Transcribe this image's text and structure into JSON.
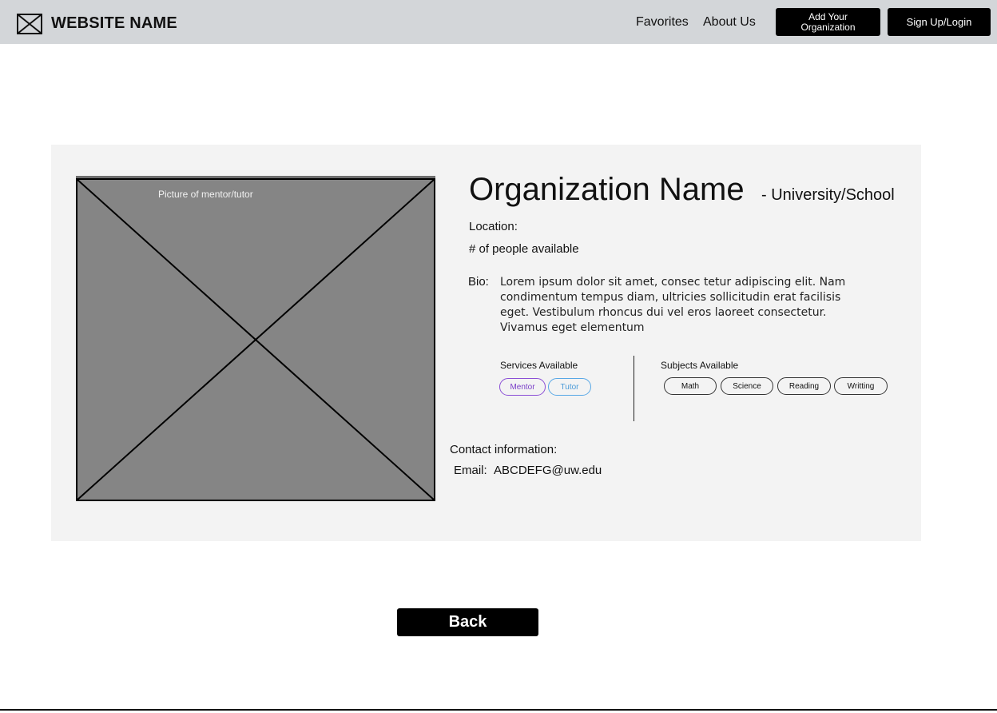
{
  "header": {
    "site_name": "WEBSITE NAME",
    "logo_icon": "image-placeholder-icon",
    "nav": {
      "favorites": "Favorites",
      "about": "About Us"
    },
    "add_org_line1": "Add Your",
    "add_org_line2": "Organization",
    "signup": "Sign Up/Login"
  },
  "profile": {
    "photo_label": "Picture of mentor/tutor",
    "org_name": "Organization Name",
    "org_type": "- University/School",
    "location_label": "Location:",
    "people_label": "# of people available",
    "bio_label": "Bio:",
    "bio_text": "Lorem ipsum dolor sit amet, consec tetur adipiscing elit. Nam condimentum tempus diam, ultricies sollicitudin erat facilisis eget. Vestibulum rhoncus dui vel eros laoreet consectetur. Vivamus eget elementum",
    "services_title": "Services Available",
    "services": [
      "Mentor",
      "Tutor"
    ],
    "subjects_title": "Subjects Available",
    "subjects": [
      "Math",
      "Science",
      "Reading",
      "Writting"
    ],
    "contact_title": "Contact information:",
    "email_label": "Email:",
    "email_value": "ABCDEFG@uw.edu"
  },
  "footer": {
    "back": "Back"
  },
  "colors": {
    "header_bg": "#d3d6d9",
    "card_bg": "#f3f3f3",
    "mentor": "#8b4fd6",
    "tutor": "#58a8e6"
  }
}
